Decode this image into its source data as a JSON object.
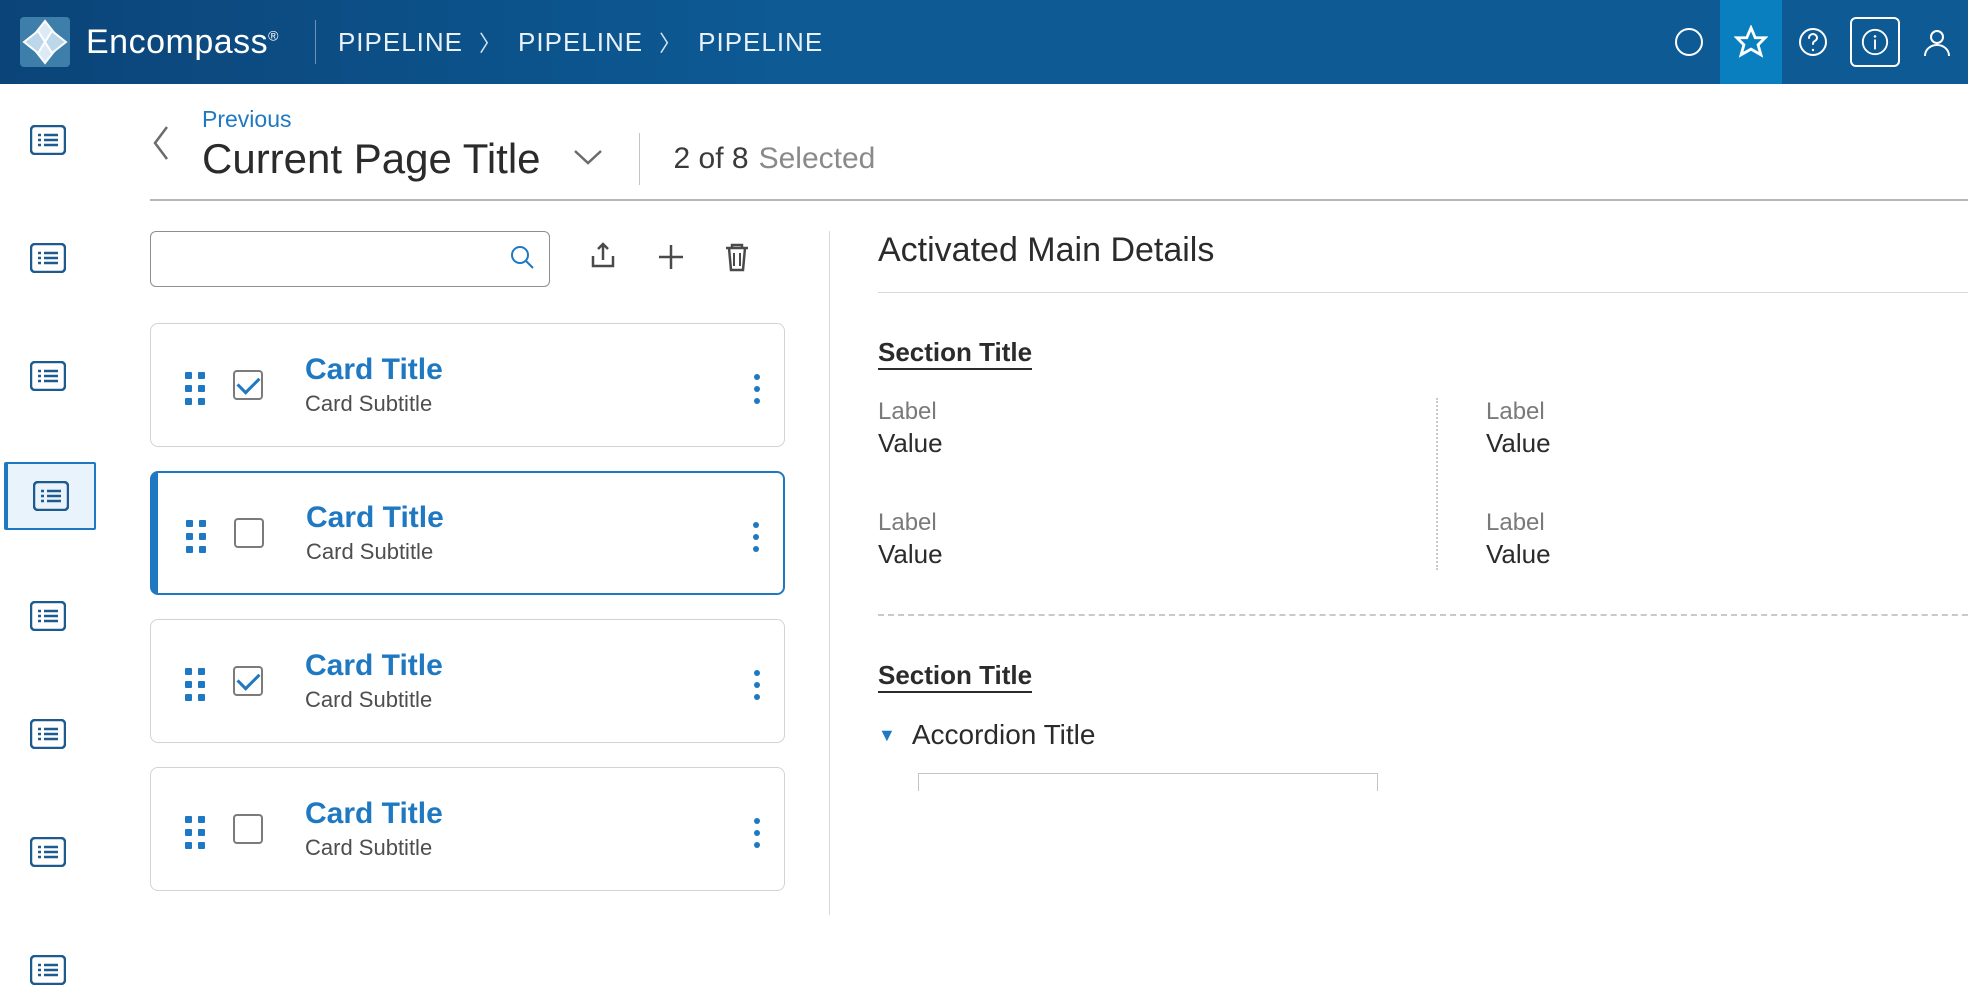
{
  "app": {
    "name": "Encompass"
  },
  "breadcrumb": [
    "PIPELINE",
    "PIPELINE",
    "PIPELINE"
  ],
  "page": {
    "previous_label": "Previous",
    "title": "Current Page Title",
    "counter": "2 of 8",
    "selected_label": "Selected"
  },
  "search": {
    "placeholder": ""
  },
  "cards": [
    {
      "title": "Card Title",
      "subtitle": "Card Subtitle",
      "checked": true,
      "active": false
    },
    {
      "title": "Card Title",
      "subtitle": "Card Subtitle",
      "checked": false,
      "active": true
    },
    {
      "title": "Card Title",
      "subtitle": "Card Subtitle",
      "checked": true,
      "active": false
    },
    {
      "title": "Card Title",
      "subtitle": "Card Subtitle",
      "checked": false,
      "active": false
    }
  ],
  "details": {
    "heading": "Activated Main Details",
    "section1": {
      "title": "Section Title",
      "fields": [
        {
          "label": "Label",
          "value": "Value"
        },
        {
          "label": "Label",
          "value": "Value"
        },
        {
          "label": "Label",
          "value": "Value"
        },
        {
          "label": "Label",
          "value": "Value"
        }
      ]
    },
    "section2": {
      "title": "Section Title",
      "accordion_title": "Accordion Title"
    }
  },
  "colors": {
    "accent": "#1e79c2",
    "header": "#0d5a95"
  }
}
